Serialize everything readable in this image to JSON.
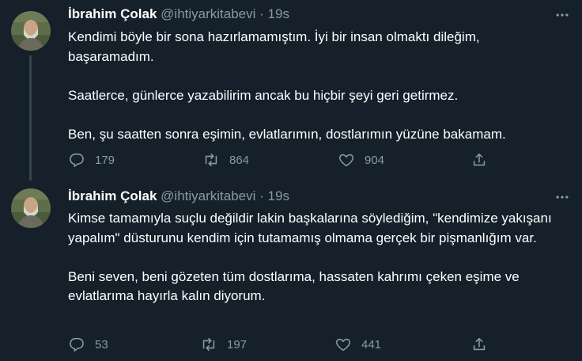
{
  "tweets": [
    {
      "author_name": "İbrahim Çolak",
      "handle": "@ihtiyarkitabevi",
      "separator": "·",
      "time": "19s",
      "paragraphs": [
        "Kendimi böyle bir sona hazırlamamıştım. İyi bir insan olmaktı dileğim, başaramadım.",
        "Saatlerce, günlerce yazabilirim ancak bu hiçbir şeyi geri getirmez.",
        "Ben, şu saatten sonra eşimin, evlatlarımın, dostlarımın yüzüne bakamam."
      ],
      "replies": "179",
      "retweets": "864",
      "likes": "904"
    },
    {
      "author_name": "İbrahim Çolak",
      "handle": "@ihtiyarkitabevi",
      "separator": "·",
      "time": "19s",
      "paragraphs": [
        "Kimse tamamıyla suçlu değildir lakin başkalarına söylediğim,  \"kendimize yakışanı yapalım\" düsturunu kendim için tutamamış olmama gerçek bir pişmanlığım var.",
        "Beni seven, beni gözeten tüm dostlarıma, hassaten kahrımı çeken eşime ve evlatlarıma hayırla kalın diyorum."
      ],
      "replies": "53",
      "retweets": "197",
      "likes": "441"
    }
  ],
  "icons": {
    "reply": "reply-icon",
    "retweet": "retweet-icon",
    "like": "like-icon",
    "share": "share-icon",
    "more": "more-icon"
  },
  "colors": {
    "background": "#15202b",
    "secondary_text": "#8899a6",
    "thread_line": "#38444d"
  }
}
